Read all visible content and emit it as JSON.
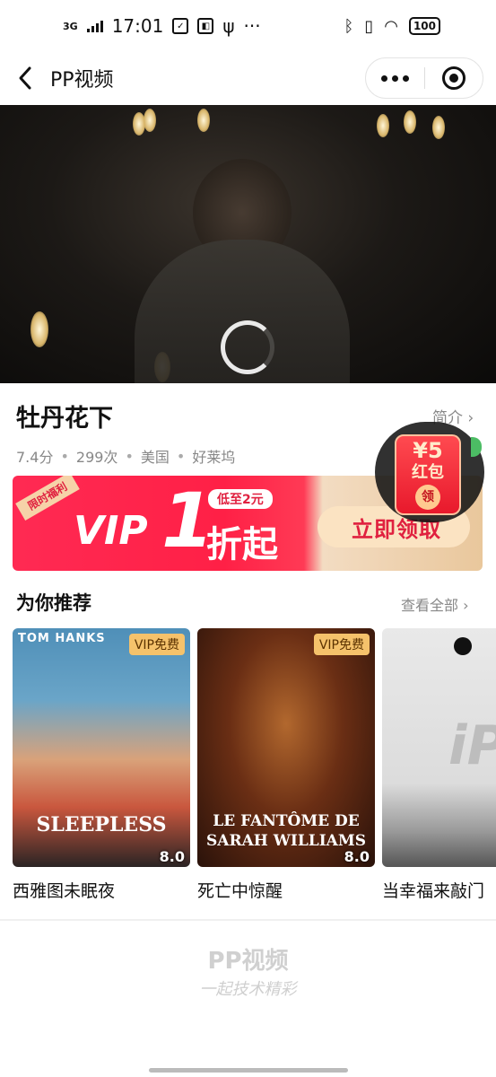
{
  "status_bar": {
    "network": "3G",
    "time": "17:01",
    "battery": "100",
    "more": "···"
  },
  "nav": {
    "title": "PP视频"
  },
  "movie": {
    "title": "牡丹花下",
    "intro_link": "简介 ›",
    "rating": "7.4分",
    "plays": "299次",
    "region": "美国",
    "source": "好莱坞"
  },
  "banner": {
    "tag": "限时福利",
    "vip": "VIP",
    "number": "1",
    "pill": "低至2元",
    "off": "折起",
    "button": "立即领取"
  },
  "red_packet": {
    "amount": "¥5",
    "label": "红包",
    "claim": "领"
  },
  "recommend": {
    "title": "为你推荐",
    "view_all": "查看全部 ›",
    "items": [
      {
        "name": "西雅图未眠夜",
        "badge": "VIP免费",
        "score": "8.0",
        "poster_top": "TOM HANKS",
        "poster_title": "SLEEPLESS"
      },
      {
        "name": "死亡中惊醒",
        "badge": "VIP免费",
        "score": "8.0",
        "poster_top": "",
        "poster_title": "LE FANTÔME DE SARAH WILLIAMS"
      },
      {
        "name": "当幸福来敲门"
      }
    ]
  },
  "footer": {
    "logo": "PP视频",
    "slogan": "一起技术精彩"
  }
}
